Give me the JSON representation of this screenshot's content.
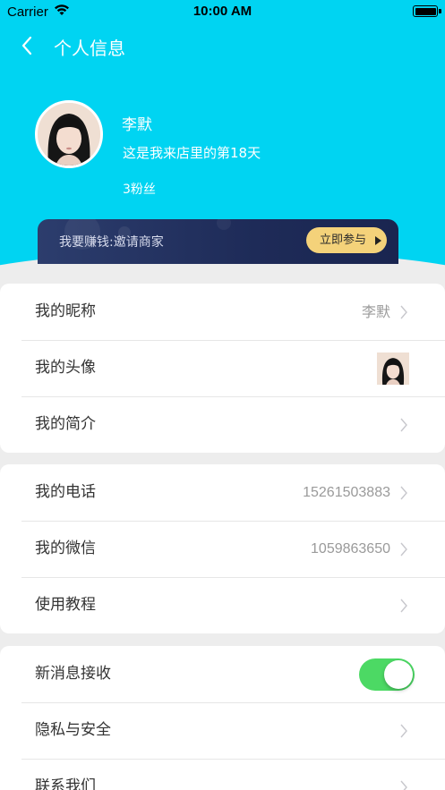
{
  "status_bar": {
    "carrier": "Carrier",
    "time": "10:00 AM",
    "wifi_icon": "wifi-icon",
    "battery_icon": "battery-icon"
  },
  "nav": {
    "title": "个人信息",
    "back_icon": "chevron-left-icon"
  },
  "profile": {
    "name": "李默",
    "days": "这是我来店里的第18天",
    "fans": "3粉丝",
    "avatar": "avatar-photo"
  },
  "banner": {
    "text": "我要赚钱:邀请商家",
    "button": "立即参与",
    "button_icon": "play-triangle-icon"
  },
  "section1": [
    {
      "label": "我的昵称",
      "value": "李默"
    },
    {
      "label": "我的头像"
    },
    {
      "label": "我的简介",
      "value": ""
    }
  ],
  "section2": [
    {
      "label": "我的电话",
      "value": "15261503883"
    },
    {
      "label": "我的微信",
      "value": "1059863650"
    },
    {
      "label": "使用教程",
      "value": ""
    }
  ],
  "section3": [
    {
      "label": "新消息接收",
      "toggle_on": true
    },
    {
      "label": "隐私与安全",
      "value": ""
    },
    {
      "label": "联系我们",
      "value": ""
    }
  ],
  "colors": {
    "header": "#00d4f2",
    "banner_bg": "#1e2b58",
    "banner_button": "#f4d27a",
    "toggle_on": "#4cd964"
  }
}
